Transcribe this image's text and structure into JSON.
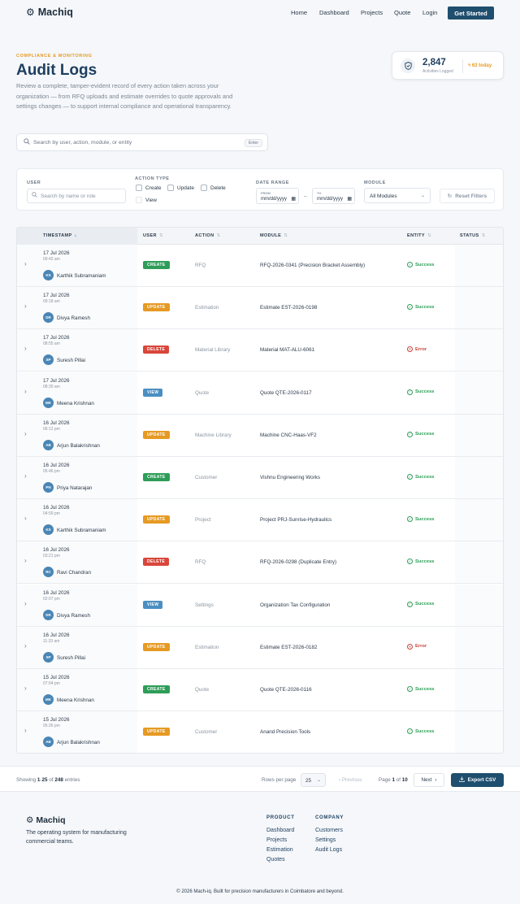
{
  "brand": {
    "name": "Machiq",
    "icon": "gear-icon"
  },
  "nav": {
    "links": [
      "Home",
      "Dashboard",
      "Projects",
      "Quote",
      "Login"
    ],
    "cta": "Get Started"
  },
  "header": {
    "eyebrow": "COMPLIANCE & MONITORING",
    "title": "Audit Logs",
    "description": "Review a complete, tamper-evident record of every action taken across your organization — from RFQ uploads and estimate overrides to quote approvals and settings changes — to support internal compliance and operational transparency."
  },
  "stats": {
    "count": "2,847",
    "label": "Activities Logged",
    "today": "63 today",
    "icon": "shield-icon",
    "today_icon": "bolt-icon"
  },
  "search": {
    "placeholder": "Search by user, action, module, or entity",
    "key": "Enter"
  },
  "filters": {
    "user_label": "USER",
    "user_placeholder": "Search by name or role",
    "action_label": "ACTION TYPE",
    "actions": [
      "Create",
      "Update",
      "Delete",
      "View"
    ],
    "date_label": "DATE RANGE",
    "from_caption": "FROM",
    "to_caption": "TO",
    "date_placeholder": "mm/dd/yyyy",
    "module_label": "MODULE",
    "module_value": "All Modules",
    "reset_label": "Reset Filters"
  },
  "table": {
    "columns": [
      "TIMESTAMP",
      "USER",
      "ACTION",
      "MODULE",
      "ENTITY",
      "STATUS"
    ],
    "rows": [
      {
        "date": "17 Jul 2026",
        "time": "09:42 am",
        "initials": "KS",
        "user": "Karthik Subramaniam",
        "action": "CREATE",
        "module": "RFQ",
        "entity": "RFQ-2026-0341 (Precision Bracket Assembly)",
        "status": "Success"
      },
      {
        "date": "17 Jul 2026",
        "time": "09:18 am",
        "initials": "DR",
        "user": "Divya Ramesh",
        "action": "UPDATE",
        "module": "Estimation",
        "entity": "Estimate EST-2026-0198",
        "status": "Success"
      },
      {
        "date": "17 Jul 2026",
        "time": "08:55 am",
        "initials": "SP",
        "user": "Suresh Pillai",
        "action": "DELETE",
        "module": "Material Library",
        "entity": "Material MAT-ALU-6061",
        "status": "Error"
      },
      {
        "date": "17 Jul 2026",
        "time": "08:30 am",
        "initials": "MK",
        "user": "Meena Krishnan",
        "action": "VIEW",
        "module": "Quote",
        "entity": "Quote QTE-2026-0117",
        "status": "Success"
      },
      {
        "date": "16 Jul 2026",
        "time": "06:12 pm",
        "initials": "AB",
        "user": "Arjun Balakrishnan",
        "action": "UPDATE",
        "module": "Machine Library",
        "entity": "Machine CNC-Haas-VF2",
        "status": "Success"
      },
      {
        "date": "16 Jul 2026",
        "time": "05:46 pm",
        "initials": "PN",
        "user": "Priya Natarajan",
        "action": "CREATE",
        "module": "Customer",
        "entity": "Vishnu Engineering Works",
        "status": "Success"
      },
      {
        "date": "16 Jul 2026",
        "time": "04:59 pm",
        "initials": "KS",
        "user": "Karthik Subramaniam",
        "action": "UPDATE",
        "module": "Project",
        "entity": "Project PRJ-Sunrise-Hydraulics",
        "status": "Success"
      },
      {
        "date": "16 Jul 2026",
        "time": "03:21 pm",
        "initials": "RC",
        "user": "Ravi Chandran",
        "action": "DELETE",
        "module": "RFQ",
        "entity": "RFQ-2026-0298 (Duplicate Entry)",
        "status": "Success"
      },
      {
        "date": "16 Jul 2026",
        "time": "02:07 pm",
        "initials": "DR",
        "user": "Divya Ramesh",
        "action": "VIEW",
        "module": "Settings",
        "entity": "Organization Tax Configuration",
        "status": "Success"
      },
      {
        "date": "16 Jul 2026",
        "time": "11:33 am",
        "initials": "SP",
        "user": "Suresh Pillai",
        "action": "UPDATE",
        "module": "Estimation",
        "entity": "Estimate EST-2026-0182",
        "status": "Error"
      },
      {
        "date": "15 Jul 2026",
        "time": "07:04 pm",
        "initials": "MK",
        "user": "Meena Krishnan",
        "action": "CREATE",
        "module": "Quote",
        "entity": "Quote QTE-2026-0116",
        "status": "Success"
      },
      {
        "date": "15 Jul 2026",
        "time": "05:26 pm",
        "initials": "AB",
        "user": "Arjun Balakrishnan",
        "action": "UPDATE",
        "module": "Customer",
        "entity": "Anand Precision Tools",
        "status": "Success"
      }
    ]
  },
  "colors": {
    "CREATE": "#2e9d58",
    "UPDATE": "#e69a23",
    "DELETE": "#d9473b",
    "VIEW": "#4a8fc2",
    "Success": "#2e9d58",
    "Error": "#c9453a"
  },
  "pager": {
    "showing_prefix": "Showing",
    "from": "1",
    "to": "25",
    "of_word": "of",
    "total": "248",
    "suffix": "entries",
    "rows_label": "Rows per page",
    "rows_value": "25",
    "prev": "Previous",
    "page_word": "Page",
    "page": "1",
    "page_of": "of",
    "pages": "10",
    "next": "Next",
    "export": "Export CSV"
  },
  "footer": {
    "brand": "Machiq",
    "tagline": "The operating system for manufacturing commercial teams.",
    "product_heading": "PRODUCT",
    "product_links": [
      "Dashboard",
      "Projects",
      "Estimation",
      "Quotes"
    ],
    "company_heading": "COMPANY",
    "company_links": [
      "Customers",
      "Settings",
      "Audit Logs"
    ],
    "copyright": "© 2026 Mach-iq. Built for precision manufacturers in Coimbatore and beyond."
  }
}
